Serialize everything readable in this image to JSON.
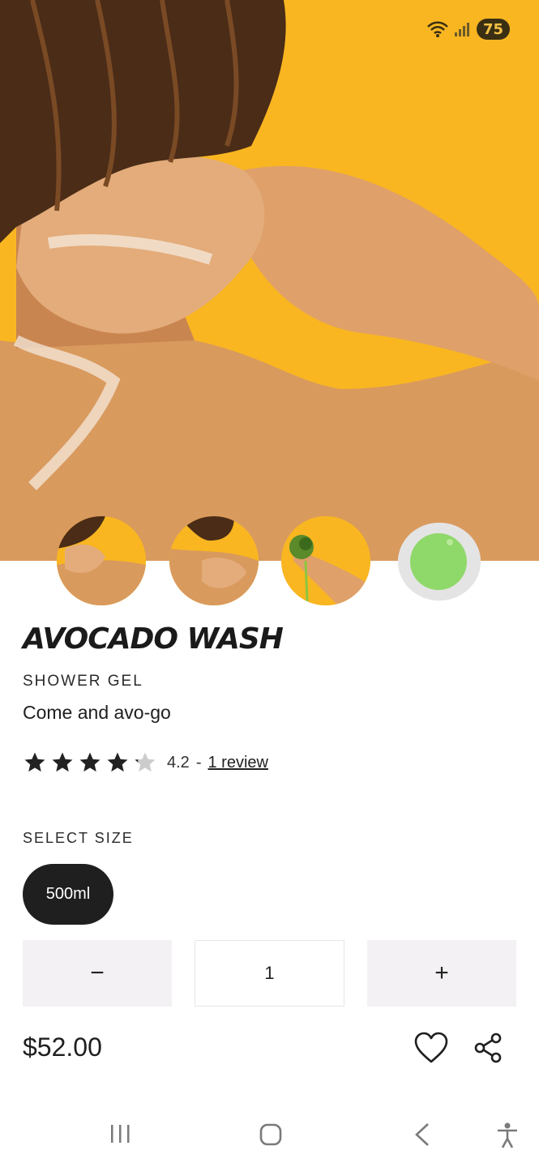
{
  "status_bar": {
    "battery": "75",
    "wifi_icon": "wifi-icon",
    "signal_icon": "signal-icon"
  },
  "product": {
    "title": "AVOCADO WASH",
    "category": "SHOWER GEL",
    "tagline": "Come and avo-go",
    "rating": {
      "stars": 4.2,
      "max": 5,
      "value_label": "4.2",
      "separator": "-",
      "review_link": "1 review"
    },
    "size_label": "SELECT SIZE",
    "sizes": [
      {
        "label": "500ml",
        "selected": true
      }
    ],
    "quantity": {
      "minus": "−",
      "value": "1",
      "plus": "+"
    },
    "price": "$52.00"
  },
  "colors": {
    "hero_bg": "#f9b621",
    "chip_bg": "#1f1f1f",
    "qty_bg": "#f3f1f3",
    "star": "#222222",
    "star_empty": "#cccccc"
  },
  "icons": {
    "wishlist": "heart-icon",
    "share": "share-icon"
  },
  "nav": {
    "recents": "recents-icon",
    "home": "home-icon",
    "back": "back-icon",
    "accessibility": "accessibility-icon"
  }
}
